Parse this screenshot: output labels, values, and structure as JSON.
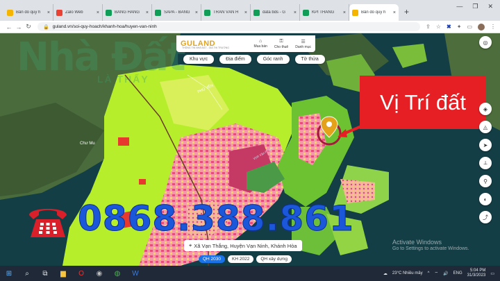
{
  "browser": {
    "tabs": [
      {
        "label": "Bản đồ quy h",
        "fav": "#f4b400"
      },
      {
        "label": "Zalo Web",
        "fav": "#e94235"
      },
      {
        "label": "BẢNG HÀNG",
        "fav": "#0f9d58"
      },
      {
        "label": "SAPA - BẢNG",
        "fav": "#0f9d58"
      },
      {
        "label": "TRẦN VĂN H",
        "fav": "#0f9d58"
      },
      {
        "label": "data bds - G",
        "fav": "#0f9d58"
      },
      {
        "label": "KPI THÁNG",
        "fav": "#0f9d58"
      },
      {
        "label": "Bản đồ quy h",
        "fav": "#f4b400"
      }
    ],
    "tab_close": "×",
    "new_tab": "+",
    "url": "guland.vn/soi-quy-hoach/khanh-hoa/huyen-van-ninh"
  },
  "guland": {
    "logo": "GULAND",
    "tagline": "THÔNG TIN NHÀ ĐẤT - GIÁ THỊ TRƯỜNG",
    "menu": [
      {
        "label": "Mua bán",
        "icon": "store-icon"
      },
      {
        "label": "Cho thuê",
        "icon": "key-icon"
      },
      {
        "label": "Danh mục",
        "icon": "menu-icon"
      }
    ]
  },
  "filters": [
    "Khu vực",
    "Địa điểm",
    "Góc ranh",
    "Tờ thửa"
  ],
  "overlay": {
    "location_title": "Vị Trí đất",
    "phone": "0868.388.861",
    "watermark": "Nhà Đất",
    "watermark_sub": "LÀ THẤY"
  },
  "map_labels": [
    "Chư Mu",
    "PHÚ YÊN",
    "Vịnh Vân Phong"
  ],
  "location_bar": "Xã Vạn Thắng, Huyện Vạn Ninh, Khánh Hòa",
  "layers": [
    {
      "label": "QH 2030",
      "active": true
    },
    {
      "label": "KH 2022",
      "active": false
    },
    {
      "label": "QH xây dựng",
      "active": false
    }
  ],
  "activate": {
    "title": "Activate Windows",
    "sub": "Go to Settings to activate Windows."
  },
  "taskbar": {
    "weather": "23°C  Nhiều mây",
    "lang": "ENG",
    "time": "5:04 PM",
    "date": "31/3/2023"
  }
}
